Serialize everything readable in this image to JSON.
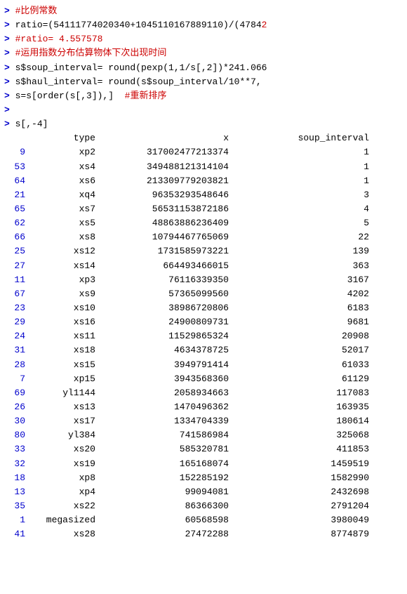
{
  "console": {
    "header_lines": [
      {
        "id": 1,
        "prompt": "> ",
        "text": "#比例常数",
        "isComment": true
      },
      {
        "id": 2,
        "prompt": "> ",
        "text": "ratio=(54111774020340+1045110167889110)/(47842",
        "isComment": false,
        "truncated": true
      },
      {
        "id": 3,
        "prompt": "> ",
        "text": "#ratio= 4.557578",
        "isComment": true
      },
      {
        "id": 4,
        "prompt": "> ",
        "text": "#运用指数分布估算物体下次出现时间",
        "isComment": true
      },
      {
        "id": 5,
        "prompt": "> ",
        "text": "s$soup_interval= round(pexp(1,1/s[,2])*241.066",
        "isComment": false,
        "truncated": true
      },
      {
        "id": 6,
        "prompt": "> ",
        "text": "s$haul_interval= round(s$soup_interval/10**7,",
        "isComment": false,
        "truncated": true
      },
      {
        "id": 7,
        "prompt": "> ",
        "text": "s=s[order(s[,3]),]  #重新排序",
        "isComment": false
      },
      {
        "id": 8,
        "prompt": ">",
        "text": "",
        "isComment": false
      },
      {
        "id": 9,
        "prompt": "> ",
        "text": "s[,-4]",
        "isComment": false
      }
    ],
    "table": {
      "headers": {
        "rownum": "",
        "type": "type",
        "x": "x",
        "soup_interval": "soup_interval"
      },
      "rows": [
        {
          "rownum": "9",
          "type": "xp2",
          "x": "317002477213374",
          "soup": "1"
        },
        {
          "rownum": "53",
          "type": "xs4",
          "x": "349488121314104",
          "soup": "1"
        },
        {
          "rownum": "64",
          "type": "xs6",
          "x": "213309779203821",
          "soup": "1"
        },
        {
          "rownum": "21",
          "type": "xq4",
          "x": "96353293548646",
          "soup": "3"
        },
        {
          "rownum": "65",
          "type": "xs7",
          "x": "56531153872186",
          "soup": "4"
        },
        {
          "rownum": "62",
          "type": "xs5",
          "x": "48863886236409",
          "soup": "5"
        },
        {
          "rownum": "66",
          "type": "xs8",
          "x": "10794467765069",
          "soup": "22"
        },
        {
          "rownum": "25",
          "type": "xs12",
          "x": "1731585973221",
          "soup": "139"
        },
        {
          "rownum": "27",
          "type": "xs14",
          "x": "664493466015",
          "soup": "363"
        },
        {
          "rownum": "11",
          "type": "xp3",
          "x": "76116339350",
          "soup": "3167"
        },
        {
          "rownum": "67",
          "type": "xs9",
          "x": "57365099560",
          "soup": "4202"
        },
        {
          "rownum": "23",
          "type": "xs10",
          "x": "38986720806",
          "soup": "6183"
        },
        {
          "rownum": "29",
          "type": "xs16",
          "x": "24900809731",
          "soup": "9681"
        },
        {
          "rownum": "24",
          "type": "xs11",
          "x": "11529865324",
          "soup": "20908"
        },
        {
          "rownum": "31",
          "type": "xs18",
          "x": "4634378725",
          "soup": "52017"
        },
        {
          "rownum": "28",
          "type": "xs15",
          "x": "3949791414",
          "soup": "61033"
        },
        {
          "rownum": "7",
          "type": "xp15",
          "x": "3943568360",
          "soup": "61129"
        },
        {
          "rownum": "69",
          "type": "yl1144",
          "x": "2058934663",
          "soup": "117083"
        },
        {
          "rownum": "26",
          "type": "xs13",
          "x": "1470496362",
          "soup": "163935"
        },
        {
          "rownum": "30",
          "type": "xs17",
          "x": "1334704339",
          "soup": "180614"
        },
        {
          "rownum": "80",
          "type": "yl384",
          "x": "741586984",
          "soup": "325068"
        },
        {
          "rownum": "33",
          "type": "xs20",
          "x": "585320781",
          "soup": "411853"
        },
        {
          "rownum": "32",
          "type": "xs19",
          "x": "165168074",
          "soup": "1459519"
        },
        {
          "rownum": "18",
          "type": "xp8",
          "x": "152285192",
          "soup": "1582990"
        },
        {
          "rownum": "13",
          "type": "xp4",
          "x": "99094081",
          "soup": "2432698"
        },
        {
          "rownum": "35",
          "type": "xs22",
          "x": "86366300",
          "soup": "2791204"
        },
        {
          "rownum": "1",
          "type": "megasized",
          "x": "60568598",
          "soup": "3980049"
        },
        {
          "rownum": "41",
          "type": "xs28",
          "x": "27472288",
          "soup": "8774879"
        }
      ]
    }
  }
}
